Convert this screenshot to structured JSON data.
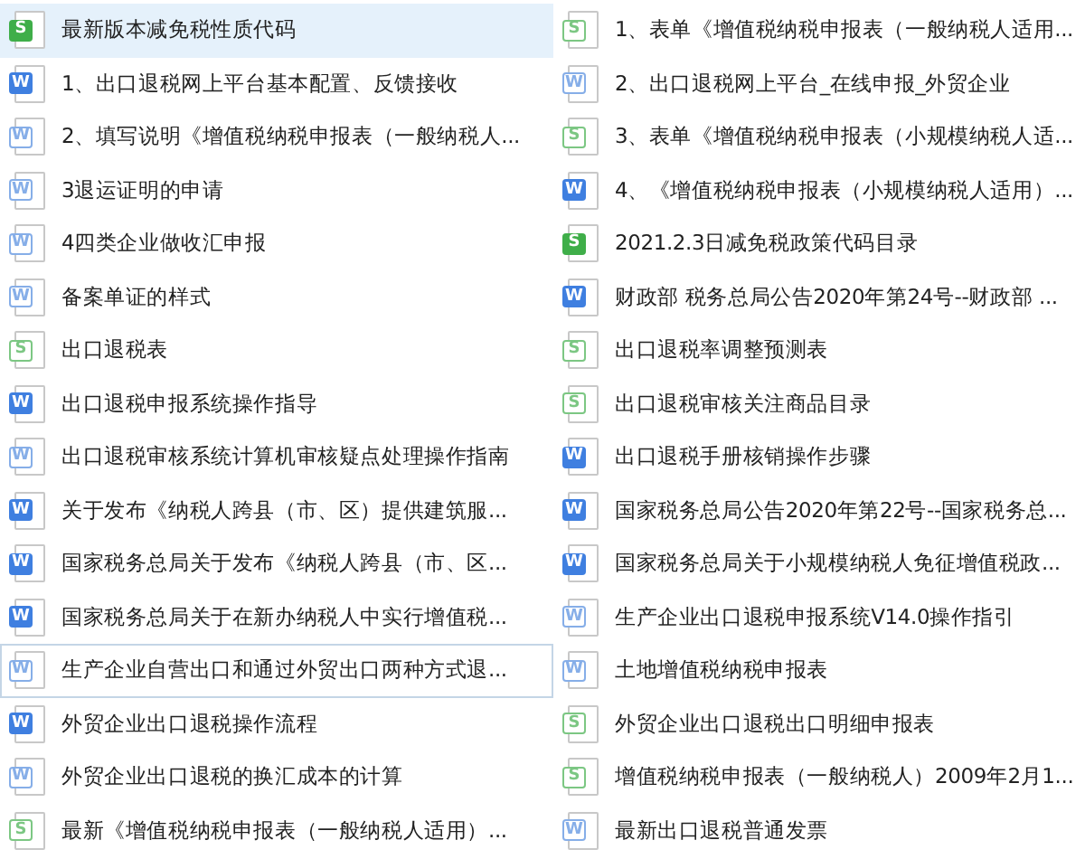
{
  "columns": [
    {
      "items": [
        {
          "kind": "sheet",
          "badge": "S",
          "solid": true,
          "name": "最新版本减免税性质代码",
          "selected": true,
          "focused": false
        },
        {
          "kind": "doc",
          "badge": "W",
          "solid": true,
          "name": "1、出口退税网上平台基本配置、反馈接收",
          "selected": false,
          "focused": false
        },
        {
          "kind": "doc",
          "badge": "W",
          "solid": false,
          "name": "2、填写说明《增值税纳税申报表（一般纳税人...",
          "selected": false,
          "focused": false
        },
        {
          "kind": "doc",
          "badge": "W",
          "solid": false,
          "name": "3退运证明的申请",
          "selected": false,
          "focused": false
        },
        {
          "kind": "doc",
          "badge": "W",
          "solid": false,
          "name": "4四类企业做收汇申报",
          "selected": false,
          "focused": false
        },
        {
          "kind": "doc",
          "badge": "W",
          "solid": false,
          "name": "备案单证的样式",
          "selected": false,
          "focused": false
        },
        {
          "kind": "sheet",
          "badge": "S",
          "solid": false,
          "name": "出口退税表",
          "selected": false,
          "focused": false
        },
        {
          "kind": "doc",
          "badge": "W",
          "solid": true,
          "name": "出口退税申报系统操作指导",
          "selected": false,
          "focused": false
        },
        {
          "kind": "doc",
          "badge": "W",
          "solid": false,
          "name": "出口退税审核系统计算机审核疑点处理操作指南",
          "selected": false,
          "focused": false
        },
        {
          "kind": "doc",
          "badge": "W",
          "solid": true,
          "name": "关于发布《纳税人跨县（市、区）提供建筑服...",
          "selected": false,
          "focused": false
        },
        {
          "kind": "doc",
          "badge": "W",
          "solid": true,
          "name": "国家税务总局关于发布《纳税人跨县（市、区...",
          "selected": false,
          "focused": false
        },
        {
          "kind": "doc",
          "badge": "W",
          "solid": true,
          "name": "国家税务总局关于在新办纳税人中实行增值税...",
          "selected": false,
          "focused": false
        },
        {
          "kind": "doc",
          "badge": "W",
          "solid": false,
          "name": "生产企业自营出口和通过外贸出口两种方式退...",
          "selected": false,
          "focused": true
        },
        {
          "kind": "doc",
          "badge": "W",
          "solid": true,
          "name": "外贸企业出口退税操作流程",
          "selected": false,
          "focused": false
        },
        {
          "kind": "doc",
          "badge": "W",
          "solid": false,
          "name": "外贸企业出口退税的换汇成本的计算",
          "selected": false,
          "focused": false
        },
        {
          "kind": "sheet",
          "badge": "S",
          "solid": false,
          "name": "最新《增值税纳税申报表（一般纳税人适用）...",
          "selected": false,
          "focused": false
        }
      ]
    },
    {
      "items": [
        {
          "kind": "sheet",
          "badge": "S",
          "solid": false,
          "name": "1、表单《增值税纳税申报表（一般纳税人适用...",
          "selected": false,
          "focused": false
        },
        {
          "kind": "doc",
          "badge": "W",
          "solid": false,
          "name": "2、出口退税网上平台_在线申报_外贸企业",
          "selected": false,
          "focused": false
        },
        {
          "kind": "sheet",
          "badge": "S",
          "solid": false,
          "name": "3、表单《增值税纳税申报表（小规模纳税人适...",
          "selected": false,
          "focused": false
        },
        {
          "kind": "doc",
          "badge": "W",
          "solid": true,
          "name": "4、《增值税纳税申报表（小规模纳税人适用）...",
          "selected": false,
          "focused": false
        },
        {
          "kind": "sheet",
          "badge": "S",
          "solid": true,
          "name": "2021.2.3日减免税政策代码目录",
          "selected": false,
          "focused": false
        },
        {
          "kind": "doc",
          "badge": "W",
          "solid": true,
          "name": "财政部 税务总局公告2020年第24号--财政部 ...",
          "selected": false,
          "focused": false
        },
        {
          "kind": "sheet",
          "badge": "S",
          "solid": false,
          "name": "出口退税率调整预测表",
          "selected": false,
          "focused": false
        },
        {
          "kind": "sheet",
          "badge": "S",
          "solid": false,
          "name": "出口退税审核关注商品目录",
          "selected": false,
          "focused": false
        },
        {
          "kind": "doc",
          "badge": "W",
          "solid": true,
          "name": "出口退税手册核销操作步骤",
          "selected": false,
          "focused": false
        },
        {
          "kind": "doc",
          "badge": "W",
          "solid": true,
          "name": "国家税务总局公告2020年第22号--国家税务总...",
          "selected": false,
          "focused": false
        },
        {
          "kind": "doc",
          "badge": "W",
          "solid": true,
          "name": "国家税务总局关于小规模纳税人免征增值税政...",
          "selected": false,
          "focused": false
        },
        {
          "kind": "doc",
          "badge": "W",
          "solid": false,
          "name": "生产企业出口退税申报系统V14.0操作指引",
          "selected": false,
          "focused": false
        },
        {
          "kind": "doc",
          "badge": "W",
          "solid": false,
          "name": "土地增值税纳税申报表",
          "selected": false,
          "focused": false
        },
        {
          "kind": "sheet",
          "badge": "S",
          "solid": false,
          "name": "外贸企业出口退税出口明细申报表",
          "selected": false,
          "focused": false
        },
        {
          "kind": "sheet",
          "badge": "S",
          "solid": false,
          "name": "增值税纳税申报表（一般纳税人）2009年2月1...",
          "selected": false,
          "focused": false
        },
        {
          "kind": "doc",
          "badge": "W",
          "solid": false,
          "name": "最新出口退税普通发票",
          "selected": false,
          "focused": false
        }
      ]
    }
  ]
}
